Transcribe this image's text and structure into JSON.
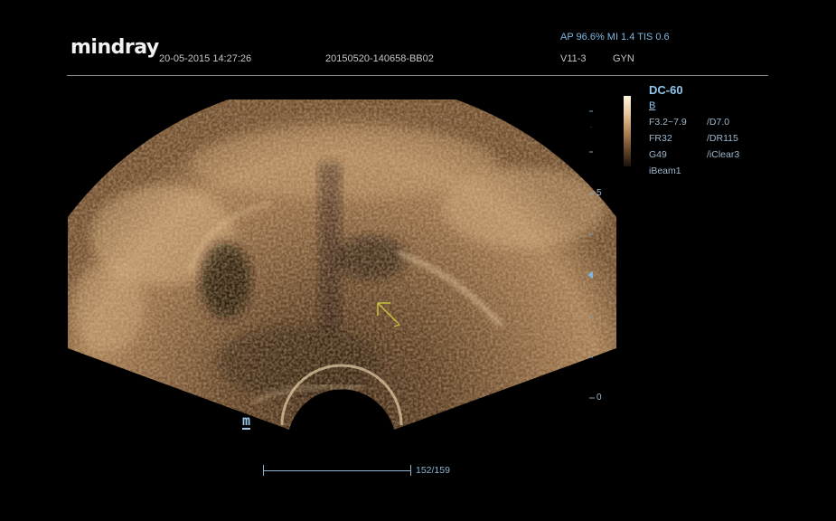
{
  "brand": "mindray",
  "header": {
    "datetime": "20-05-2015 14:27:26",
    "exam_id": "20150520-140658-BB02",
    "acoustic": "AP 96.6%  MI 1.4  TIS 0.6",
    "probe": "V11-3",
    "exam_type": "GYN"
  },
  "params": {
    "preset": "DC-60",
    "mode": "B",
    "rows": [
      {
        "left": "F3.2~7.9",
        "right": "/D7.0"
      },
      {
        "left": "FR32",
        "right": "/DR115"
      },
      {
        "left": "G49",
        "right": "/iClear3"
      },
      {
        "left": "iBeam1",
        "right": ""
      }
    ]
  },
  "depth_scale": {
    "mark_mid": "5",
    "mark_bottom": "0"
  },
  "marker": "m",
  "cine": {
    "frames": "152/159"
  },
  "colors": {
    "accent_blue": "#8ec6ee",
    "tissue": "#8a6440"
  }
}
